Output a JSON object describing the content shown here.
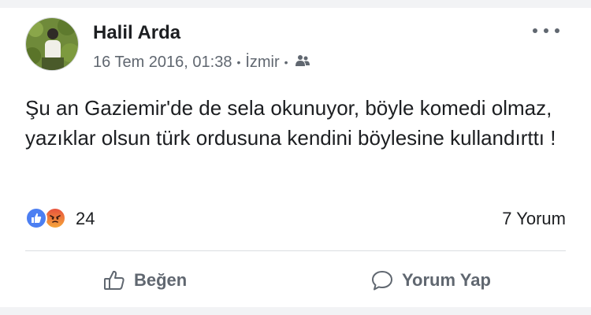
{
  "post": {
    "author": "Halil Arda",
    "timestamp": "16 Tem 2016, 01:38",
    "separator": "•",
    "location": "İzmir",
    "privacy_icon": "friends-icon",
    "more_icon": "more-options-icon",
    "text": "Şu an Gaziemir'de de sela okunuyor, böyle komedi olmaz, yazıklar olsun türk ordusuna kendini böylesine kullandırttı !"
  },
  "reactions": {
    "types": [
      "like",
      "angry"
    ],
    "count": "24",
    "comments": "7 Yorum"
  },
  "actions": {
    "like_label": "Beğen",
    "comment_label": "Yorum Yap"
  },
  "colors": {
    "like_blue": "#4c7ff2",
    "text_gray": "#606770",
    "divider": "#dadde1"
  }
}
